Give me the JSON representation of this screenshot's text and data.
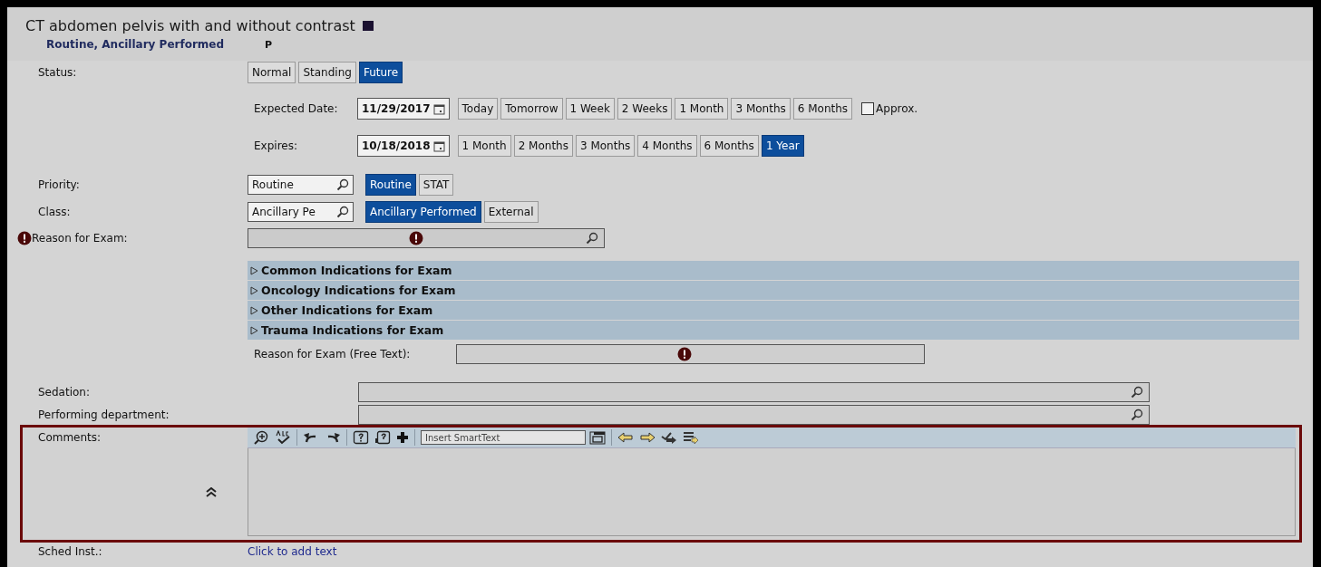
{
  "order": {
    "title": "CT abdomen pelvis with and without contrast",
    "summary": "Routine, Ancillary Performed",
    "flag": "P"
  },
  "status": {
    "label": "Status:",
    "options": [
      {
        "label": "Normal",
        "selected": false
      },
      {
        "label": "Standing",
        "selected": false
      },
      {
        "label": "Future",
        "selected": true
      }
    ]
  },
  "expected_date": {
    "label": "Expected Date:",
    "value": "11/29/2017",
    "shortcuts": [
      "Today",
      "Tomorrow",
      "1 Week",
      "2 Weeks",
      "1 Month",
      "3 Months",
      "6 Months"
    ],
    "approx": {
      "label": "Approx.",
      "checked": false
    }
  },
  "expires": {
    "label": "Expires:",
    "value": "10/18/2018",
    "options": [
      {
        "label": "1 Month",
        "selected": false
      },
      {
        "label": "2 Months",
        "selected": false
      },
      {
        "label": "3 Months",
        "selected": false
      },
      {
        "label": "4 Months",
        "selected": false
      },
      {
        "label": "6 Months",
        "selected": false
      },
      {
        "label": "1 Year",
        "selected": true
      }
    ]
  },
  "priority": {
    "label": "Priority:",
    "value": "Routine",
    "options": [
      {
        "label": "Routine",
        "selected": true
      },
      {
        "label": "STAT",
        "selected": false
      }
    ]
  },
  "class": {
    "label": "Class:",
    "value": "Ancillary Pe",
    "options": [
      {
        "label": "Ancillary Performed",
        "selected": true
      },
      {
        "label": "External",
        "selected": false
      }
    ]
  },
  "reason": {
    "label": "Reason for Exam:",
    "required": true
  },
  "indications": [
    {
      "label": "Common Indications for Exam",
      "expanded": false
    },
    {
      "label": "Oncology Indications for Exam",
      "expanded": false
    },
    {
      "label": "Other Indications for Exam",
      "expanded": false
    },
    {
      "label": "Trauma Indications for Exam",
      "expanded": false
    }
  ],
  "free_text": {
    "label": "Reason for Exam (Free Text):",
    "required": true
  },
  "sedation": {
    "label": "Sedation:"
  },
  "performing_department": {
    "label": "Performing department:"
  },
  "comments": {
    "label": "Comments:",
    "smarttext_placeholder": "Insert SmartText"
  },
  "sched_inst": {
    "label": "Sched Inst.:",
    "link": "Click to add text"
  }
}
